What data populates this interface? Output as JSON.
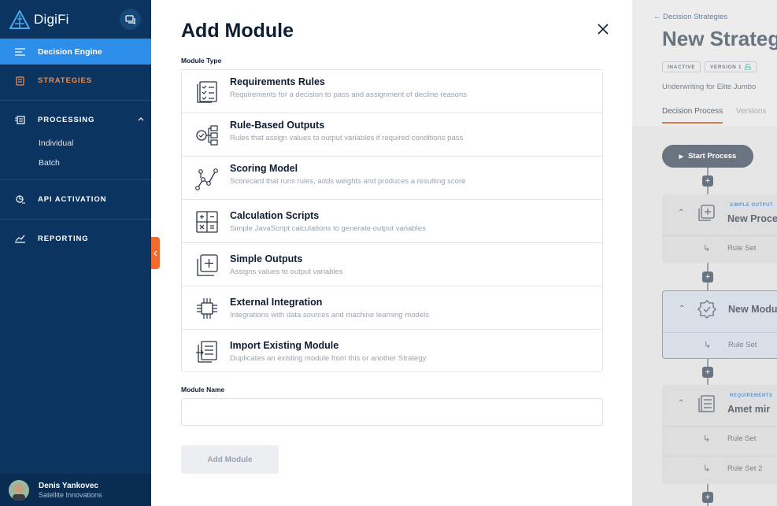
{
  "sidebar": {
    "brand": "DigiFi",
    "items": [
      {
        "label": "Decision Engine",
        "icon": "menu-lines-icon"
      },
      {
        "label": "STRATEGIES",
        "icon": "clipboard-icon"
      },
      {
        "label": "PROCESSING",
        "icon": "processing-icon"
      },
      {
        "label": "API ACTIVATION",
        "icon": "api-icon"
      },
      {
        "label": "REPORTING",
        "icon": "chart-line-icon"
      }
    ],
    "processing_subitems": [
      "Individual",
      "Batch"
    ],
    "user": {
      "name": "Denis Yankovec",
      "company": "Satellite Innovations"
    }
  },
  "modal": {
    "title": "Add Module",
    "module_type_label": "Module Type",
    "types": [
      {
        "name": "Requirements Rules",
        "desc": "Requirements for a decision to pass and assignment of decline reasons",
        "icon": "checklist-icon"
      },
      {
        "name": "Rule-Based Outputs",
        "desc": "Rules that assign values to output variables if required conditions pass",
        "icon": "rule-tree-icon"
      },
      {
        "name": "Scoring Model",
        "desc": "Scorecard that runs rules, adds weights and produces a resulting score",
        "icon": "scoring-nodes-icon"
      },
      {
        "name": "Calculation Scripts",
        "desc": "Simple JavaScript calculations to generate output variables",
        "icon": "calculator-icon"
      },
      {
        "name": "Simple Outputs",
        "desc": "Assigns values to output variables",
        "icon": "stacked-plus-icon"
      },
      {
        "name": "External Integration",
        "desc": "Integrations with data sources and machine learning models",
        "icon": "chip-icon"
      },
      {
        "name": "Import Existing Module",
        "desc": "Duplicates an existing module from this or another Strategy",
        "icon": "import-docs-icon"
      }
    ],
    "module_name_label": "Module Name",
    "module_name_value": "",
    "add_button": "Add Module"
  },
  "background": {
    "back_link": "← Decision Strategies",
    "strategy_title": "New Strateg",
    "status_badge": "INACTIVE",
    "version_badge": "VERSION 1",
    "description": "Underwriting for Elite Jumbo",
    "tabs": [
      "Decision Process",
      "Versions"
    ],
    "start_button": "Start Process",
    "plus": "+",
    "cards": [
      {
        "tag": "SIMPLE OUTPUT",
        "title": "New Proce",
        "rules": [
          "Rule Set"
        ]
      },
      {
        "tag": "",
        "title": "New Modu",
        "rules": [
          "Rule Set"
        ]
      },
      {
        "tag": "REQUIREMENTS",
        "title": "Amet mir",
        "rules": [
          "Rule Set",
          "Rule Set 2"
        ]
      }
    ]
  },
  "colors": {
    "sidebar": "#0b3560",
    "active": "#2c8ee8",
    "accent": "#f26a2e",
    "text": "#0f1d33"
  }
}
